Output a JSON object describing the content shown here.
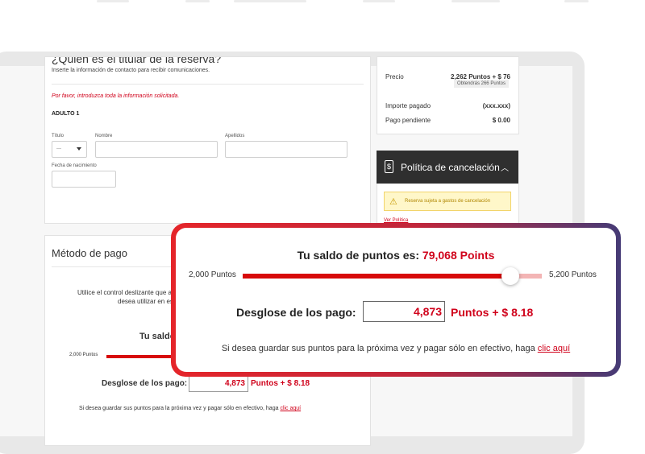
{
  "holder": {
    "title": "¿Quién es el titular de la reserva?",
    "subtitle": "Inserte la información de contacto para recibir comunicaciones.",
    "error": "Por favor, introduzca toda la información solicitada.",
    "adult_label": "ADULTO 1",
    "title_label": "Título",
    "title_value": "---",
    "name_label": "Nombre",
    "surname_label": "Apellidos",
    "birth_label": "Fecha de nacimiento"
  },
  "price": {
    "price_label": "Precio",
    "price_value": "2,262 Puntos + $ 76",
    "earn_note": "Obtendrás 266 Puntos",
    "paid_label": "Importe pagado",
    "paid_value": "(xxx.xxx)",
    "pending_label": "Pago pendiente",
    "pending_value": "$ 0.00"
  },
  "cancel": {
    "title": "Política de cancelación",
    "warning": "Reserva sujeta a gastos de cancelación",
    "link": "Ver Política"
  },
  "payment": {
    "title": "Método de pago",
    "instructions_1": "Utilice el control deslizante que ap",
    "instructions_2": "desea utilizar en esta",
    "balance_partial": "Tu saldo d",
    "min_label": "2,000 Puntos",
    "breakdown_label": "Desglose de los pago:",
    "points_value": "4,873",
    "points_suffix": "Puntos + $ 8.18",
    "save_text": "Si desea guardar sus puntos para la próxima vez y pagar sólo en efectivo, haga",
    "save_link": "clic aquí"
  },
  "overlay": {
    "balance_label": "Tu saldo de puntos es:",
    "balance_value": "79,068 Points",
    "min_label": "2,000 Puntos",
    "max_label": "5,200 Puntos",
    "slider_fraction": 0.895,
    "breakdown_label": "Desglose de los pago:",
    "points_value": "4,873",
    "points_suffix": "Puntos + $ 8.18",
    "save_text": "Si desea guardar sus puntos para la próxima vez y pagar sólo en efectivo, haga",
    "save_link": "clic aquí"
  },
  "colors": {
    "accent": "#d0021b",
    "dark_header": "#2f2f2f",
    "gradient_end": "#453b76"
  }
}
